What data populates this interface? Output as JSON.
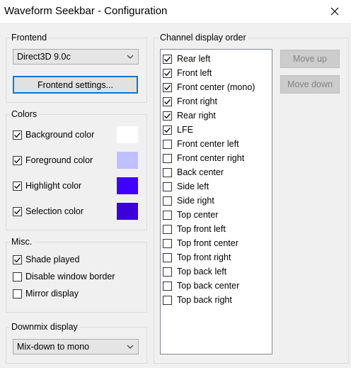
{
  "window": {
    "title": "Waveform Seekbar - Configuration",
    "close_icon": "close-icon"
  },
  "frontend": {
    "label": "Frontend",
    "selected": "Direct3D 9.0c",
    "settings_button": "Frontend settings..."
  },
  "colors": {
    "label": "Colors",
    "items": [
      {
        "label": "Background color",
        "checked": true,
        "color": "#ffffff"
      },
      {
        "label": "Foreground color",
        "checked": true,
        "color": "#c0c0ff"
      },
      {
        "label": "Highlight color",
        "checked": true,
        "color": "#4000ff"
      },
      {
        "label": "Selection color",
        "checked": true,
        "color": "#3c00d9"
      }
    ]
  },
  "misc": {
    "label": "Misc.",
    "items": [
      {
        "label": "Shade played",
        "checked": true
      },
      {
        "label": "Disable window border",
        "checked": false
      },
      {
        "label": "Mirror display",
        "checked": false
      }
    ]
  },
  "downmix": {
    "label": "Downmix display",
    "selected": "Mix-down to mono"
  },
  "channels": {
    "label": "Channel display order",
    "move_up": "Move up",
    "move_down": "Move down",
    "items": [
      {
        "label": "Rear left",
        "checked": true
      },
      {
        "label": "Front left",
        "checked": true
      },
      {
        "label": "Front center (mono)",
        "checked": true
      },
      {
        "label": "Front right",
        "checked": true
      },
      {
        "label": "Rear right",
        "checked": true
      },
      {
        "label": "LFE",
        "checked": true
      },
      {
        "label": "Front center left",
        "checked": false
      },
      {
        "label": "Front center right",
        "checked": false
      },
      {
        "label": "Back center",
        "checked": false
      },
      {
        "label": "Side left",
        "checked": false
      },
      {
        "label": "Side right",
        "checked": false
      },
      {
        "label": "Top center",
        "checked": false
      },
      {
        "label": "Top front left",
        "checked": false
      },
      {
        "label": "Top front center",
        "checked": false
      },
      {
        "label": "Top front right",
        "checked": false
      },
      {
        "label": "Top back left",
        "checked": false
      },
      {
        "label": "Top back center",
        "checked": false
      },
      {
        "label": "Top back right",
        "checked": false
      }
    ]
  }
}
